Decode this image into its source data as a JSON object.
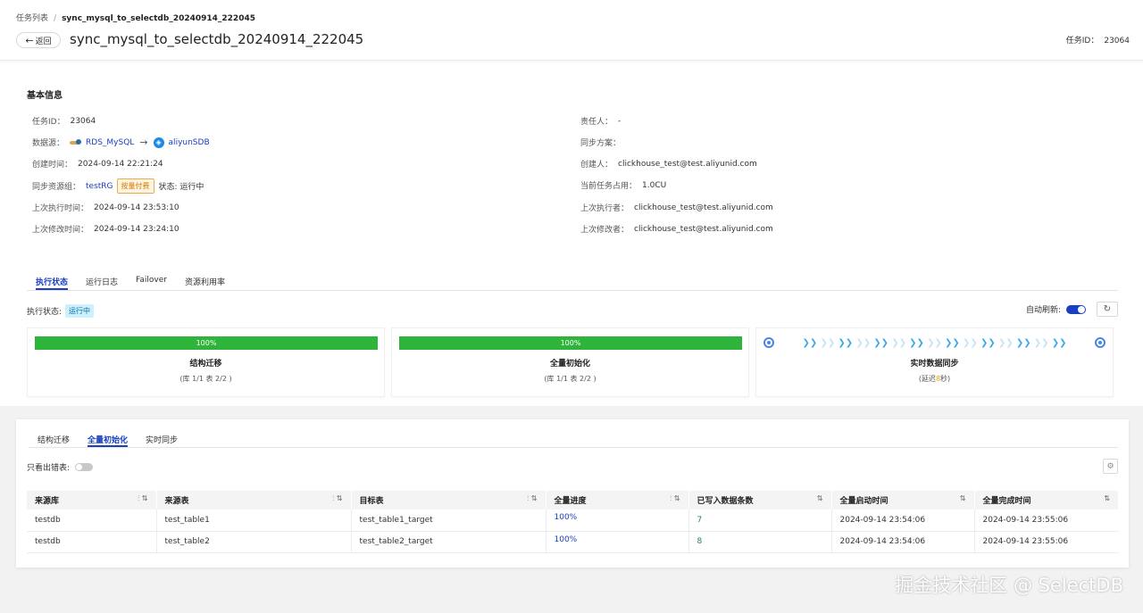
{
  "header": {
    "breadcrumb_root": "任务列表",
    "breadcrumb_sep": "/",
    "breadcrumb_current": "sync_mysql_to_selectdb_20240914_222045",
    "back_label": "返回",
    "title": "sync_mysql_to_selectdb_20240914_222045",
    "task_id_label": "任务ID：",
    "task_id_value": "23064"
  },
  "basic_info": {
    "title": "基本信息",
    "task_id_label": "任务ID：",
    "task_id": "23064",
    "datasource_label": "数据源：",
    "source_name": "RDS_MySQL",
    "arrow": "→",
    "target_name": "aliyunSDB",
    "created_label": "创建时间：",
    "created": "2024-09-14 22:21:24",
    "resource_group_label": "同步资源组：",
    "resource_group": "testRG",
    "billing_tag": "按量付费",
    "status_text": "状态: 运行中",
    "last_exec_label": "上次执行时间：",
    "last_exec": "2024-09-14 23:53:10",
    "last_mod_label": "上次修改时间：",
    "last_mod": "2024-09-14 23:24:10",
    "owner_label": "责任人：",
    "owner": "-",
    "plan_label": "同步方案：",
    "plan": "",
    "creator_label": "创建人：",
    "creator": "clickhouse_test@test.aliyunid.com",
    "usage_label": "当前任务占用：",
    "usage": "1.0CU",
    "last_executor_label": "上次执行者：",
    "last_executor": "clickhouse_test@test.aliyunid.com",
    "last_modifier_label": "上次修改者：",
    "last_modifier": "clickhouse_test@test.aliyunid.com"
  },
  "main_tabs": [
    {
      "label": "执行状态"
    },
    {
      "label": "运行日志"
    },
    {
      "label": "Failover"
    },
    {
      "label": "资源利用率"
    }
  ],
  "exec": {
    "status_label": "执行状态:",
    "status_value": "运行中",
    "auto_refresh_label": "自动刷新:",
    "refresh_icon": "↻"
  },
  "cards": [
    {
      "progress_text": "100%",
      "progress": 1.0,
      "title": "结构迁移",
      "sub": "(库 1/1 表 2/2 )"
    },
    {
      "progress_text": "100%",
      "progress": 1.0,
      "title": "全量初始化",
      "sub": "(库 1/1 表 2/2 )"
    },
    {
      "title": "实时数据同步",
      "sub_prefix": "(延迟",
      "delay": "8",
      "sub_suffix": "秒)"
    }
  ],
  "sub_tabs": [
    {
      "label": "结构迁移"
    },
    {
      "label": "全量初始化"
    },
    {
      "label": "实时同步"
    }
  ],
  "filter": {
    "only_error_label": "只看出错表:"
  },
  "table": {
    "columns": [
      "来源库",
      "来源表",
      "目标表",
      "全量进度",
      "已写入数据条数",
      "全量启动时间",
      "全量完成时间"
    ],
    "rows": [
      [
        "testdb",
        "test_table1",
        "test_table1_target",
        "100%",
        "7",
        "2024-09-14 23:54:06",
        "2024-09-14 23:55:06"
      ],
      [
        "testdb",
        "test_table2",
        "test_table2_target",
        "100%",
        "8",
        "2024-09-14 23:54:06",
        "2024-09-14 23:55:06"
      ]
    ]
  },
  "watermark": "掘金技术社区 @ SelectDB",
  "colors": {
    "accent": "#1a3fbf",
    "success": "#2eb33b",
    "warning": "#e8a400"
  }
}
